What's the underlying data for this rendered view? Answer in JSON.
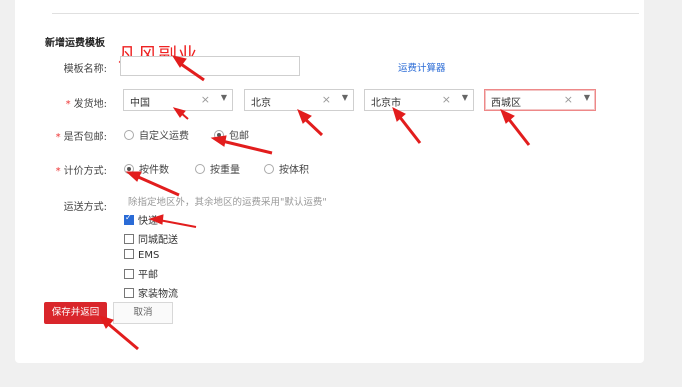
{
  "section_title": "新增运费模板",
  "watermark": "凡风副业",
  "template_name": {
    "label": "模板名称:",
    "value": ""
  },
  "calc_link": "运费计算器",
  "ship_from": {
    "label": "发货地:",
    "selects": [
      {
        "value": "中国",
        "clear": "×",
        "caret": "▼"
      },
      {
        "value": "北京",
        "clear": "×",
        "caret": "▼"
      },
      {
        "value": "北京市",
        "clear": "×",
        "caret": "▼"
      },
      {
        "value": "西城区",
        "clear": "×",
        "caret": "▼"
      }
    ]
  },
  "free_shipping": {
    "label": "是否包邮:",
    "options": [
      {
        "label": "自定义运费",
        "selected": false
      },
      {
        "label": "包邮",
        "selected": true
      }
    ]
  },
  "pricing": {
    "label": "计价方式:",
    "options": [
      {
        "label": "按件数",
        "selected": true
      },
      {
        "label": "按重量",
        "selected": false
      },
      {
        "label": "按体积",
        "selected": false
      }
    ]
  },
  "delivery": {
    "label": "运送方式:",
    "hint": "除指定地区外，其余地区的运费采用\"默认运费\"",
    "methods": [
      {
        "label": "快递",
        "checked": true
      },
      {
        "label": "同城配送",
        "checked": false
      },
      {
        "label": "EMS",
        "checked": false
      },
      {
        "label": "平邮",
        "checked": false
      },
      {
        "label": "家装物流",
        "checked": false
      }
    ]
  },
  "buttons": {
    "save": "保存并返回",
    "cancel": "取消"
  },
  "colors": {
    "primary_red": "#d9262b",
    "link_blue": "#2a6bd6",
    "arrow_red": "#e21d1d"
  }
}
